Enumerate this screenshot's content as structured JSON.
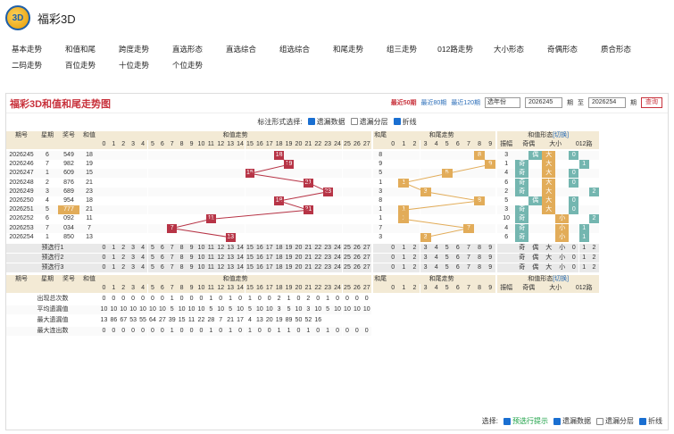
{
  "site": {
    "title": "福彩3D",
    "logo_text": "3D"
  },
  "nav": {
    "row1": [
      "基本走势",
      "和值和尾",
      "跨度走势",
      "直选形态",
      "直选综合",
      "组选综合",
      "和尾走势",
      "组三走势",
      "012路走势",
      "大小形态",
      "奇偶形态",
      "质合形态"
    ],
    "row2": [
      "二码走势",
      "百位走势",
      "十位走势",
      "个位走势"
    ]
  },
  "panel": {
    "title": "福彩3D和值和尾走势图",
    "recent50": "最近50期",
    "recent80": "最近80期",
    "recent120": "最近120期",
    "select": "选年份",
    "from": "2026245",
    "to_label": "至",
    "to": "2026254",
    "period": "期",
    "query": "查询"
  },
  "opts": {
    "label": "标注形式选择:",
    "o1": "遗漏数据",
    "o2": "遗漏分层",
    "o3": "折线"
  },
  "head": {
    "qihao": "期号",
    "week": "星期",
    "jiang": "奖号",
    "he": "和值",
    "sum_title": "和值走势",
    "tail_col": "和尾",
    "tail_title": "和尾走势",
    "form_title": "和值形态",
    "switch": "[切换]",
    "zhen": "振幅",
    "odd": "奇偶",
    "big": "大小",
    "road": "012路",
    "o": "奇",
    "e": "偶",
    "b": "大",
    "s": "小"
  },
  "rows": [
    {
      "q": "2026245",
      "w": "6",
      "n": "549",
      "h": "18",
      "t": "8",
      "zh": "3",
      "oe": "偶",
      "bs": "大",
      "r": "0"
    },
    {
      "q": "2026246",
      "w": "7",
      "n": "982",
      "h": "19",
      "t": "9",
      "zh": "1",
      "oe": "奇",
      "bs": "大",
      "r": "1"
    },
    {
      "q": "2026247",
      "w": "1",
      "n": "609",
      "h": "15",
      "t": "5",
      "zh": "4",
      "oe": "奇",
      "bs": "大",
      "r": "0"
    },
    {
      "q": "2026248",
      "w": "2",
      "n": "876",
      "h": "21",
      "t": "1",
      "zh": "6",
      "oe": "奇",
      "bs": "大",
      "r": "0"
    },
    {
      "q": "2026249",
      "w": "3",
      "n": "689",
      "h": "23",
      "t": "3",
      "zh": "2",
      "oe": "奇",
      "bs": "大",
      "r": "2"
    },
    {
      "q": "2026250",
      "w": "4",
      "n": "954",
      "h": "18",
      "t": "8",
      "zh": "5",
      "oe": "偶",
      "bs": "大",
      "r": "0"
    },
    {
      "q": "2026251",
      "w": "5",
      "n": "777",
      "h": "21",
      "t": "1",
      "zh": "3",
      "oe": "奇",
      "bs": "大",
      "r": "0"
    },
    {
      "q": "2026252",
      "w": "6",
      "n": "092",
      "h": "11",
      "t": "1",
      "zh": "10",
      "oe": "奇",
      "bs": "小",
      "r": "2"
    },
    {
      "q": "2026253",
      "w": "7",
      "n": "034",
      "h": "7",
      "t": "7",
      "zh": "4",
      "oe": "奇",
      "bs": "小",
      "r": "1"
    },
    {
      "q": "2026254",
      "w": "1",
      "n": "850",
      "h": "13",
      "t": "3",
      "zh": "6",
      "oe": "奇",
      "bs": "小",
      "r": "1"
    }
  ],
  "pre": [
    "预选行1",
    "预选行2",
    "预选行3"
  ],
  "stats": [
    {
      "label": "出现总次数",
      "vals": "0 0 0 0 0 0 0 1 0 0 0 1 0 1 0 1 0 0 2 1 0 2 0 1 0 0 0 0"
    },
    {
      "label": "平均遗漏值",
      "vals": "10 10 10 10 10 10 10 5 10 10 10 5 10 5 10 5 10 10 3 5 10 3 10 5 10 10 10 10"
    },
    {
      "label": "最大遗漏值",
      "vals": "13 86 67 53 55 64 27 39 15 11 22 28 7 21 17 4 13 20 19 89 50 52 16"
    },
    {
      "label": "最大连出数",
      "vals": "0 0 0 0 0 0 0 1 0 0 0 1 0 1 0 1 0 0 1 1 0 1 0 1 0 0 0 0"
    }
  ],
  "foot": {
    "label": "选择:",
    "a": "预选行提示",
    "b": "遗漏数据",
    "c": "遗漏分层",
    "d": "折线"
  },
  "colors": {
    "accent": "#c8323c",
    "hit": "#b73446",
    "tail": "#e2ac59",
    "teal": "#74b6b0"
  }
}
